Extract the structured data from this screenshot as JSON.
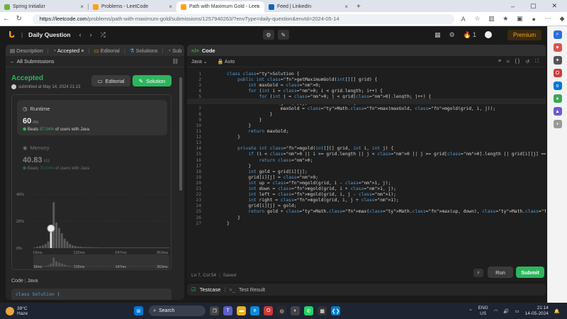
{
  "browser": {
    "tabs": [
      {
        "label": "Spring Initializr",
        "color": "#6db33f",
        "active": false
      },
      {
        "label": "Problems - LeetCode",
        "color": "#ffa116",
        "active": false
      },
      {
        "label": "Path with Maximum Gold - Leet",
        "color": "#ffa116",
        "active": true
      },
      {
        "label": "Feed | LinkedIn",
        "color": "#0a66c2",
        "active": false
      }
    ],
    "url_host": "https://leetcode.com",
    "url_path": "/problems/path-with-maximum-gold/submissions/1257940263/?envType=daily-question&envId=2024-05-14"
  },
  "lc_header": {
    "title": "Daily Question",
    "streak": "1",
    "premium_label": "Premium"
  },
  "left_panel": {
    "tabs": [
      "Description",
      "Accepted",
      "Editorial",
      "Solutions",
      "Sub"
    ],
    "all_submissions": "All Submissions",
    "status": "Accepted",
    "submitted_at": "submitted at May 14, 2024 21:13",
    "editorial_label": "Editorial",
    "solution_label": "Solution",
    "runtime_label": "Runtime",
    "runtime_value": "60",
    "runtime_unit": "ms",
    "runtime_beats_prefix": "Beats",
    "runtime_beats_pct": "87.54%",
    "runtime_beats_suffix": "of users with Java",
    "memory_label": "Memory",
    "memory_value": "40.83",
    "memory_unit": "MB",
    "memory_beats_pct": "75.64%",
    "code_label": "Code",
    "lang_label": "Java",
    "code_preview": "class Solution {"
  },
  "chart_data": {
    "type": "bar",
    "title": "",
    "ylabel": "",
    "ytick_labels": [
      "40%",
      "20%",
      "0%"
    ],
    "xtick_labels": [
      "16ms",
      "132ms",
      "247ms",
      "363ms"
    ],
    "ylim": [
      0,
      40
    ],
    "values": [
      0.5,
      1,
      1.5,
      2,
      3,
      5,
      12,
      34,
      19,
      15,
      11,
      7,
      5,
      3,
      2,
      1.5,
      1.2,
      1,
      0.8,
      0.8,
      0.7,
      0.7,
      0.6,
      0.6,
      0.5,
      0.5,
      0.5,
      0.5,
      0.5,
      0.5,
      0.5,
      0.5,
      0.5,
      0.5,
      0.5,
      0.5,
      0.5,
      0.5,
      0.5,
      0.5,
      0.5,
      0.5,
      0.5,
      0.5,
      0.5,
      0.5,
      0.5,
      0.5,
      0.5,
      0.5
    ],
    "highlight_index": 6,
    "bar_color": "#5a5a5a",
    "highlight_color": "#dddddd"
  },
  "code_panel": {
    "title": "Code",
    "language": "Java",
    "autocomplete": "Auto",
    "cursor_position": "Ln 7, Col 54",
    "save_status": "Saved",
    "run_label": "Run",
    "submit_label": "Submit",
    "lines": [
      "class Solution {",
      "    public int getMaximumGold(int[][] grid) {",
      "        int maxGold = 0;",
      "        for (int i = 0; i < grid.length; i++) {",
      "            for (int j = 0; j < grid[0].length; j++) {",
      "                if (grid[i][j] > 0) {",
      "                    maxGold = Math.max(maxGold, mgold(grid, i, j));",
      "                }",
      "            }",
      "        }",
      "        return maxGold;",
      "    }",
      "",
      "    private int mgold(int[][] grid, int i, int j) {",
      "        if (i < 0 || i >= grid.length || j < 0 || j >= grid[0].length || grid[i][j] == 0) {",
      "            return 0;",
      "        }",
      "        int gold = grid[i][j];",
      "        grid[i][j] = 0;",
      "        int up = mgold(grid, i - 1, j);",
      "        int down = mgold(grid, i + 1, j);",
      "        int left = mgold(grid, i, j - 1);",
      "        int right = mgold(grid, i, j + 1);",
      "        grid[i][j] = gold;",
      "        return gold + Math.max(Math.max(up, down), Math.max(left, right));",
      "    }",
      "}"
    ]
  },
  "bottom_panel": {
    "testcase_label": "Testcase",
    "result_label": "Test Result"
  },
  "taskbar": {
    "temperature": "39°C",
    "condition": "Haze",
    "search_placeholder": "Search",
    "lang": "ENG",
    "region": "US",
    "time": "21:14",
    "date": "14-05-2024"
  }
}
